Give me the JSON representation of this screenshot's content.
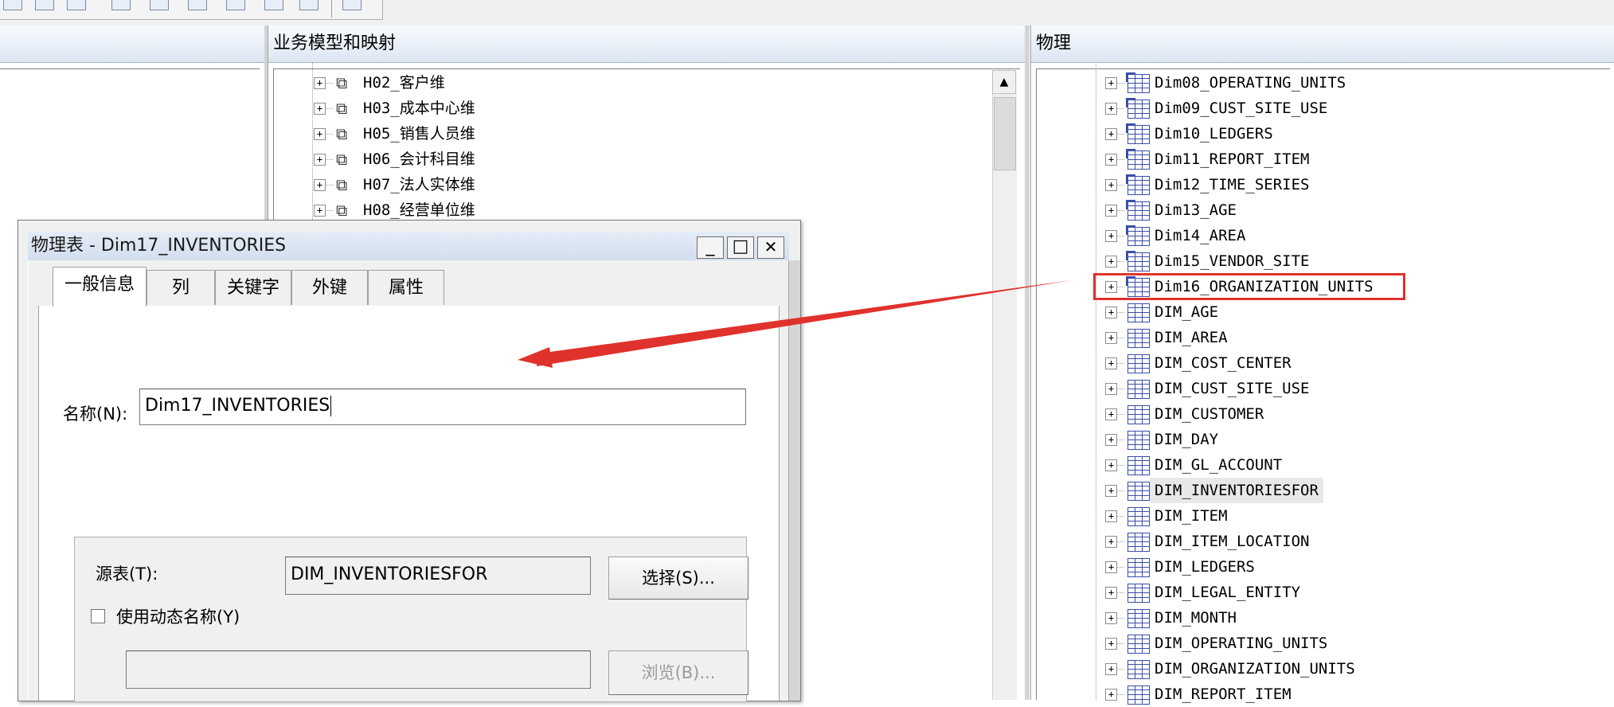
{
  "panels": {
    "business_model_header": "业务模型和映射",
    "physical_header": "物理"
  },
  "business_tree": [
    {
      "label": "H02_客户维"
    },
    {
      "label": "H03_成本中心维"
    },
    {
      "label": "H05_销售人员维"
    },
    {
      "label": "H06_会计科目维"
    },
    {
      "label": "H07_法人实体维"
    },
    {
      "label": "H08_经营单位维"
    }
  ],
  "physical_tree": [
    {
      "label": "Dim08_OPERATING_UNITS",
      "kind": "alias"
    },
    {
      "label": "Dim09_CUST_SITE_USE",
      "kind": "alias"
    },
    {
      "label": "Dim10_LEDGERS",
      "kind": "alias"
    },
    {
      "label": "Dim11_REPORT_ITEM",
      "kind": "alias"
    },
    {
      "label": "Dim12_TIME_SERIES",
      "kind": "alias"
    },
    {
      "label": "Dim13_AGE",
      "kind": "alias"
    },
    {
      "label": "Dim14_AREA",
      "kind": "alias"
    },
    {
      "label": "Dim15_VENDOR_SITE",
      "kind": "alias"
    },
    {
      "label": "Dim16_ORGANIZATION_UNITS",
      "kind": "alias",
      "highlighted": true
    },
    {
      "label": "DIM_AGE",
      "kind": "table"
    },
    {
      "label": "DIM_AREA",
      "kind": "table"
    },
    {
      "label": "DIM_COST_CENTER",
      "kind": "table"
    },
    {
      "label": "DIM_CUST_SITE_USE",
      "kind": "table"
    },
    {
      "label": "DIM_CUSTOMER",
      "kind": "table"
    },
    {
      "label": "DIM_DAY",
      "kind": "table"
    },
    {
      "label": "DIM_GL_ACCOUNT",
      "kind": "table"
    },
    {
      "label": "DIM_INVENTORIESFOR",
      "kind": "table",
      "selected": true
    },
    {
      "label": "DIM_ITEM",
      "kind": "table"
    },
    {
      "label": "DIM_ITEM_LOCATION",
      "kind": "table"
    },
    {
      "label": "DIM_LEDGERS",
      "kind": "table"
    },
    {
      "label": "DIM_LEGAL_ENTITY",
      "kind": "table"
    },
    {
      "label": "DIM_MONTH",
      "kind": "table"
    },
    {
      "label": "DIM_OPERATING_UNITS",
      "kind": "table"
    },
    {
      "label": "DIM_ORGANIZATION_UNITS",
      "kind": "table"
    },
    {
      "label": "DIM_REPORT_ITEM",
      "kind": "table"
    }
  ],
  "tree_expander_glyph": "+",
  "dialog": {
    "title": "物理表 - Dim17_INVENTORIES",
    "minimize": "_",
    "maximize": "□",
    "close": "✕",
    "tabs": [
      "一般信息",
      "列",
      "关键字",
      "外键",
      "属性"
    ],
    "name_label": "名称(N):",
    "name_value": "Dim17_INVENTORIES",
    "source_label": "源表(T):",
    "source_value": "DIM_INVENTORIESFOR",
    "select_button": "选择(S)...",
    "dynamic_name_label": "使用动态名称(Y)",
    "dynamic_name_value": "",
    "browse_button": "浏览(B)..."
  },
  "scrollbar": {
    "up_arrow": "▲"
  },
  "colors": {
    "annotation_red": "#e0322c",
    "table_icon_blue": "#3a4ea8",
    "panel_header_bg": "#dce6f2"
  }
}
